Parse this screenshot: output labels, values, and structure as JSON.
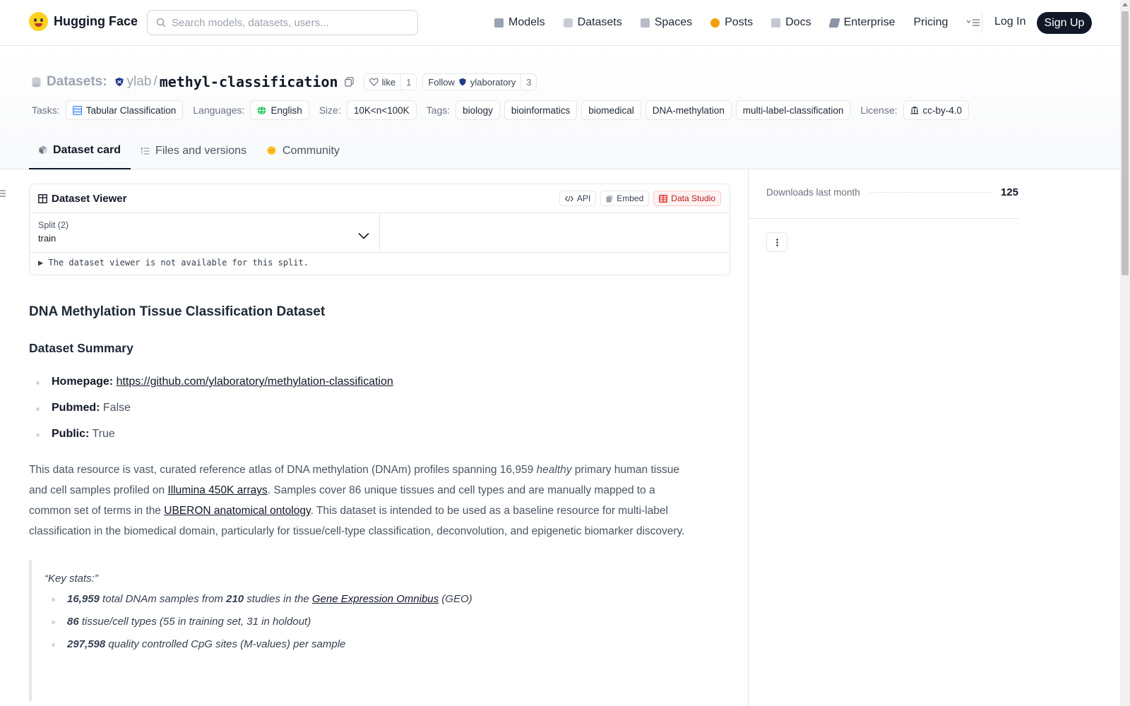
{
  "nav": {
    "brand": "Hugging Face",
    "search_placeholder": "Search models, datasets, users...",
    "links": [
      "Models",
      "Datasets",
      "Spaces",
      "Posts",
      "Docs",
      "Enterprise",
      "Pricing"
    ],
    "login": "Log In",
    "signup": "Sign Up"
  },
  "header": {
    "section_label": "Datasets:",
    "org": "ylab",
    "name": "methyl-classification",
    "like_label": "like",
    "like_count": "1",
    "follow_label": "Follow",
    "follow_org": "ylaboratory",
    "follow_count": "3",
    "tasks_key": "Tasks:",
    "task": "Tabular Classification",
    "languages_key": "Languages:",
    "language": "English",
    "size_key": "Size:",
    "size": "10K<n<100K",
    "tags_key": "Tags:",
    "tags": [
      "biology",
      "bioinformatics",
      "biomedical",
      "DNA-methylation",
      "multi-label-classification"
    ],
    "license_key": "License:",
    "license": "cc-by-4.0"
  },
  "tabs": [
    "Dataset card",
    "Files and versions",
    "Community"
  ],
  "viewer": {
    "title": "Dataset Viewer",
    "api": "API",
    "embed": "Embed",
    "studio": "Data Studio",
    "split_label": "Split (2)",
    "split_value": "train",
    "note": "The dataset viewer is not available for this split."
  },
  "card": {
    "title": "DNA Methylation Tissue Classification Dataset",
    "summary_heading": "Dataset Summary",
    "homepage_key": "Homepage:",
    "homepage_url": "https://github.com/ylaboratory/methylation-classification",
    "pubmed_key": "Pubmed:",
    "pubmed_val": "False",
    "public_key": "Public:",
    "public_val": "True",
    "p1_a": "This data resource is vast, curated reference atlas of DNA methylation (DNAm) profiles spanning 16,959 ",
    "p1_em": "healthy",
    "p1_b": " primary human tissue and cell samples profiled on ",
    "p1_link1": "Illumina 450K arrays",
    "p1_c": ". Samples cover 86 unique tissues and cell types and are manually mapped to a common set of terms in the ",
    "p1_link2": "UBERON anatomical ontology",
    "p1_d": ". This dataset is intended to be used as a baseline resource for multi-label classification in the biomedical domain, particularly for tissue/cell-type classification, deconvolution, and epigenetic biomarker discovery.",
    "quote_title": "“Key stats:”",
    "stat1_num": "16,959",
    "stat1_a": " total DNAm samples from ",
    "stat1_num2": "210",
    "stat1_b": " studies in the ",
    "stat1_link": "Gene Expression Omnibus",
    "stat1_c": " (GEO)",
    "stat2_num": "86",
    "stat2_text": " tissue/cell types (55 in training set, 31 in holdout)",
    "stat3_num": "297,598",
    "stat3_text": " quality controlled CpG sites (M-values) per sample"
  },
  "sidebar": {
    "downloads_label": "Downloads last month",
    "downloads_value": "125"
  },
  "colors": {
    "accent_dark": "#111827",
    "studio_red": "#b91c1c",
    "logo_yellow": "#ffd21e"
  }
}
